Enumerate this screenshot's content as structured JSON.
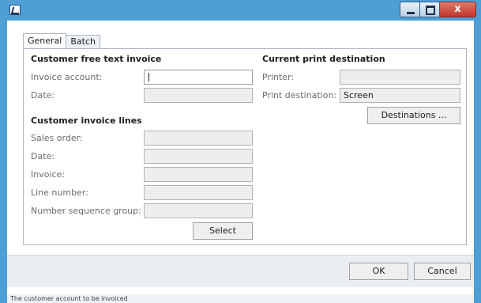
{
  "tabs": [
    {
      "label": "General",
      "active": true
    },
    {
      "label": "Batch",
      "active": false
    }
  ],
  "free_text": {
    "title": "Customer free text invoice",
    "invoice_account_label": "Invoice account:",
    "invoice_account_value": "",
    "date_label": "Date:",
    "date_value": ""
  },
  "invoice_lines": {
    "title": "Customer invoice lines",
    "sales_order_label": "Sales order:",
    "date_label": "Date:",
    "invoice_label": "Invoice:",
    "line_number_label": "Line number:",
    "number_sequence_group_label": "Number sequence group:",
    "select_label": "Select"
  },
  "print": {
    "title": "Current print destination",
    "printer_label": "Printer:",
    "printer_value": "",
    "destination_label": "Print destination:",
    "destination_value": "Screen",
    "destinations_button": "Destinations ..."
  },
  "footer": {
    "ok_label": "OK",
    "cancel_label": "Cancel"
  },
  "status": {
    "text": "The customer account to be invoiced"
  },
  "colors": {
    "title_bar": "#4f9ed6",
    "close_button": "#c2352a",
    "field_background": "#eeeeee"
  }
}
